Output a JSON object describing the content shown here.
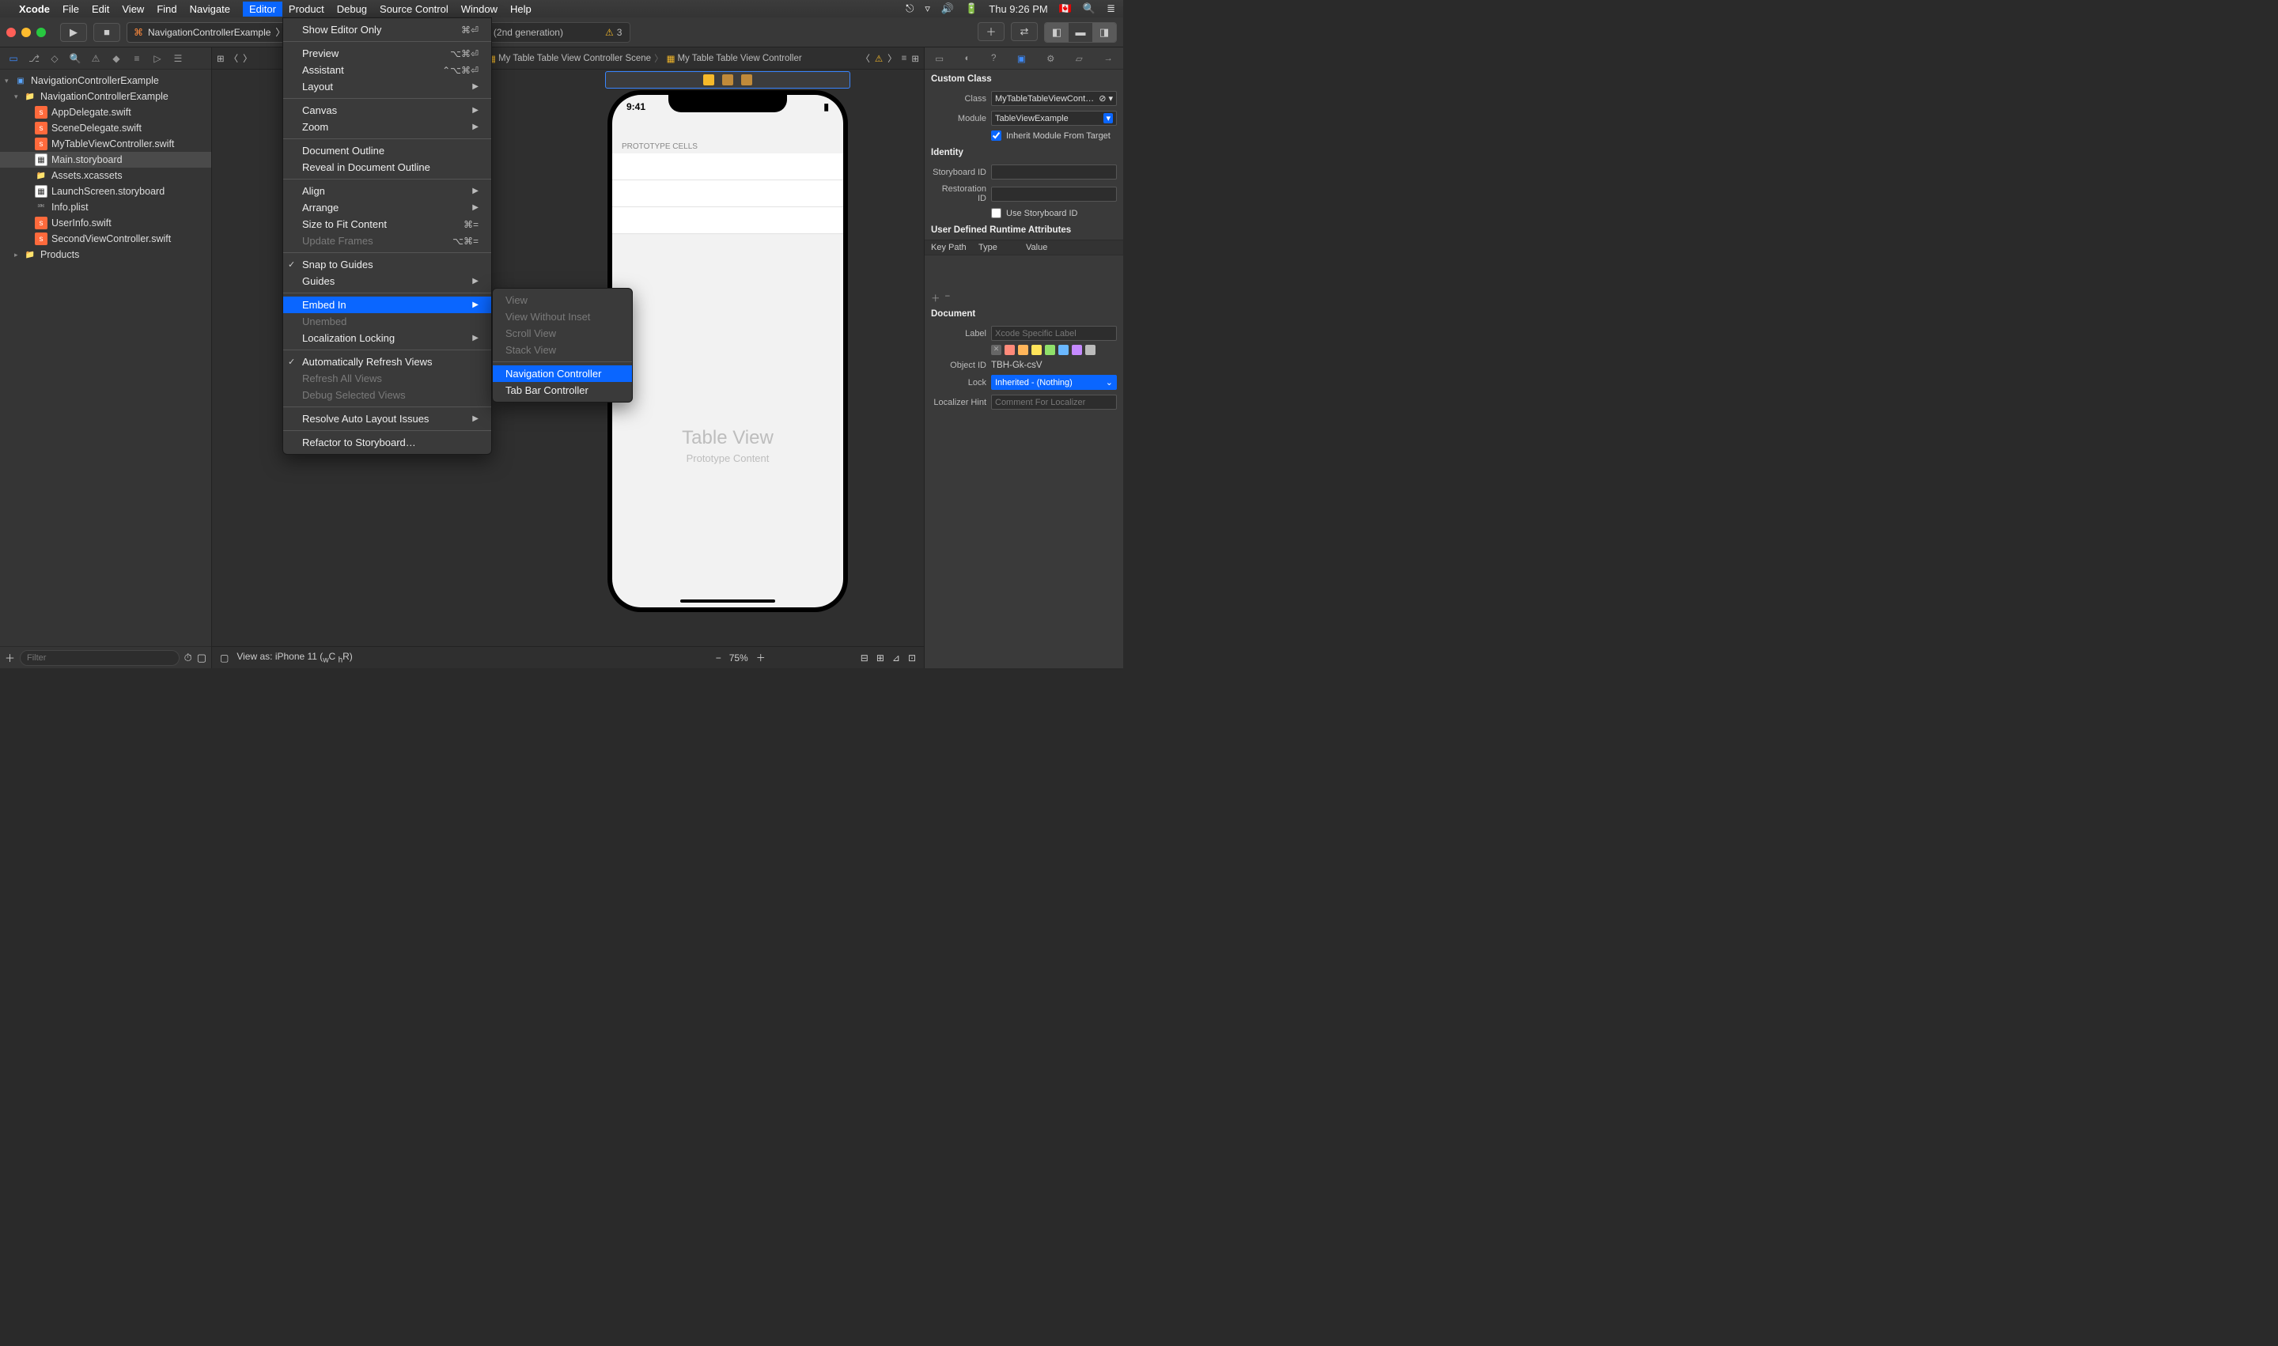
{
  "menubar": {
    "app": "Xcode",
    "items": [
      "File",
      "Edit",
      "View",
      "Find",
      "Navigate",
      "Editor",
      "Product",
      "Debug",
      "Source Control",
      "Window",
      "Help"
    ],
    "active": "Editor",
    "clock": "Thu 9:26 PM"
  },
  "toolbar": {
    "scheme_target": "NavigationControllerExample",
    "status_text": "NavigationControllerExample on iPhone SE (2nd generation)",
    "warn_count": "3"
  },
  "navigator": {
    "root": "NavigationControllerExample",
    "group": "NavigationControllerExample",
    "files": [
      {
        "name": "AppDelegate.swift",
        "kind": "swift"
      },
      {
        "name": "SceneDelegate.swift",
        "kind": "swift"
      },
      {
        "name": "MyTableViewController.swift",
        "kind": "swift"
      },
      {
        "name": "Main.storyboard",
        "kind": "sb",
        "selected": true
      },
      {
        "name": "Assets.xcassets",
        "kind": "folder"
      },
      {
        "name": "LaunchScreen.storyboard",
        "kind": "sb"
      },
      {
        "name": "Info.plist",
        "kind": "plist"
      },
      {
        "name": "UserInfo.swift",
        "kind": "swift"
      },
      {
        "name": "SecondViewController.swift",
        "kind": "swift"
      }
    ],
    "products": "Products",
    "filter_placeholder": "Filter"
  },
  "jumpbar": {
    "c1": "My Table Table View Controller Scene",
    "c2": "My Table Table View Controller"
  },
  "editor_menu": {
    "items": [
      {
        "label": "Show Editor Only",
        "shortcut": "⌘⏎"
      },
      {
        "sep": true
      },
      {
        "label": "Preview",
        "shortcut": "⌥⌘⏎"
      },
      {
        "label": "Assistant",
        "shortcut": "⌃⌥⌘⏎"
      },
      {
        "label": "Layout",
        "sub": true
      },
      {
        "sep": true
      },
      {
        "label": "Canvas",
        "sub": true
      },
      {
        "label": "Zoom",
        "sub": true
      },
      {
        "sep": true
      },
      {
        "label": "Document Outline"
      },
      {
        "label": "Reveal in Document Outline"
      },
      {
        "sep": true
      },
      {
        "label": "Align",
        "sub": true
      },
      {
        "label": "Arrange",
        "sub": true
      },
      {
        "label": "Size to Fit Content",
        "shortcut": "⌘="
      },
      {
        "label": "Update Frames",
        "shortcut": "⌥⌘=",
        "disabled": true
      },
      {
        "sep": true
      },
      {
        "label": "Snap to Guides",
        "check": true
      },
      {
        "label": "Guides",
        "sub": true
      },
      {
        "sep": true
      },
      {
        "label": "Embed In",
        "sub": true,
        "highlight": true
      },
      {
        "label": "Unembed",
        "disabled": true
      },
      {
        "label": "Localization Locking",
        "sub": true
      },
      {
        "sep": true
      },
      {
        "label": "Automatically Refresh Views",
        "check": true
      },
      {
        "label": "Refresh All Views",
        "disabled": true
      },
      {
        "label": "Debug Selected Views",
        "disabled": true
      },
      {
        "sep": true
      },
      {
        "label": "Resolve Auto Layout Issues",
        "sub": true
      },
      {
        "sep": true
      },
      {
        "label": "Refactor to Storyboard…"
      }
    ]
  },
  "embed_submenu": [
    {
      "label": "View",
      "disabled": true
    },
    {
      "label": "View Without Inset",
      "disabled": true
    },
    {
      "label": "Scroll View",
      "disabled": true
    },
    {
      "label": "Stack View",
      "disabled": true
    },
    {
      "sep": true
    },
    {
      "label": "Navigation Controller",
      "highlight": true
    },
    {
      "label": "Tab Bar Controller"
    }
  ],
  "canvas": {
    "time": "9:41",
    "proto_label": "PROTOTYPE CELLS",
    "tv_big": "Table View",
    "tv_sm": "Prototype Content",
    "view_as": "View as: iPhone 11 (",
    "view_as2": "C",
    "view_as3": "R)",
    "zoom": "75%"
  },
  "inspector": {
    "custom_class": "Custom Class",
    "class_label": "Class",
    "class_value": "MyTableTableViewCont…",
    "module_label": "Module",
    "module_value": "TableViewExample",
    "inherit": "Inherit Module From Target",
    "identity": "Identity",
    "storyboard_id": "Storyboard ID",
    "restoration_id": "Restoration ID",
    "use_sb_id": "Use Storyboard ID",
    "udra": "User Defined Runtime Attributes",
    "th_keypath": "Key Path",
    "th_type": "Type",
    "th_value": "Value",
    "document": "Document",
    "label_l": "Label",
    "label_ph": "Xcode Specific Label",
    "object_id_l": "Object ID",
    "object_id_v": "TBH-Gk-csV",
    "lock_l": "Lock",
    "lock_v": "Inherited - (Nothing)",
    "loc_hint_l": "Localizer Hint",
    "loc_hint_ph": "Comment For Localizer"
  }
}
